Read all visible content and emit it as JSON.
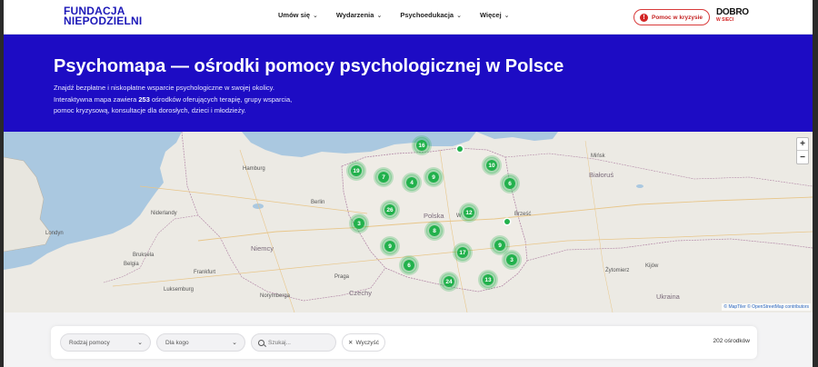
{
  "header": {
    "logo_line1": "FUNDACJA",
    "logo_line2": "NIEPODZIELNI",
    "menu": [
      {
        "label": "Umów się"
      },
      {
        "label": "Wydarzenia"
      },
      {
        "label": "Psychoedukacja"
      },
      {
        "label": "Więcej"
      }
    ],
    "crisis_button": "Pomoc w kryzysie",
    "crisis_icon": "!",
    "partner_logo": "DOBRO",
    "partner_sub": "W SIECI"
  },
  "hero": {
    "title": "Psychomapa — ośrodki pomocy psychologicznej w Polsce",
    "line1": "Znajdź bezpłatne i niskopłatne wsparcie psychologiczne w swojej okolicy.",
    "line2_pre": "Interaktywna mapa zawiera ",
    "line2_count": "253",
    "line2_post": " ośrodków oferujących terapię, grupy wsparcia,",
    "line3": "pomoc kryzysową, konsultacje dla dorosłych, dzieci i młodzieży."
  },
  "map": {
    "clusters": [
      "16",
      "19",
      "7",
      "4",
      "9",
      "10",
      "6",
      "26",
      "12",
      "3",
      "8",
      "9",
      "17",
      "9",
      "3",
      "6",
      "24",
      "13"
    ],
    "labels": {
      "polska": "Polska",
      "niemcy": "Niemcy",
      "bialorus": "Białoruś",
      "ukraina": "Ukraina",
      "niderlandy": "Niderlandy",
      "czechy": "Czechy",
      "berlin": "Berlin",
      "hamburg": "Hamburg",
      "londyn": "Londyn",
      "bruksela": "Bruksela",
      "belgia": "Belgia",
      "luksemburg": "Luksemburg",
      "praga": "Praga",
      "frankfurt": "Frankfurt",
      "norymberga": "Norymberga",
      "minsk": "Mińsk",
      "kijow": "Kijów",
      "zytomierz": "Żytomierz",
      "brzesc": "Brześć",
      "warszawa_w": "W"
    },
    "zoom_in": "+",
    "zoom_out": "−",
    "attribution_maptiler": "© MapTiler",
    "attribution_osm": "© OpenStreetMap contributors"
  },
  "filters": {
    "type_placeholder": "Rodzaj pomocy",
    "audience_placeholder": "Dla kogo",
    "search_placeholder": "Szukaj...",
    "clear_label": "Wyczyść",
    "result_count": "202 ośrodków"
  },
  "colors": {
    "brand_blue": "#1d0cc4",
    "cluster_green": "#22b14c",
    "crisis_red": "#d32626"
  }
}
